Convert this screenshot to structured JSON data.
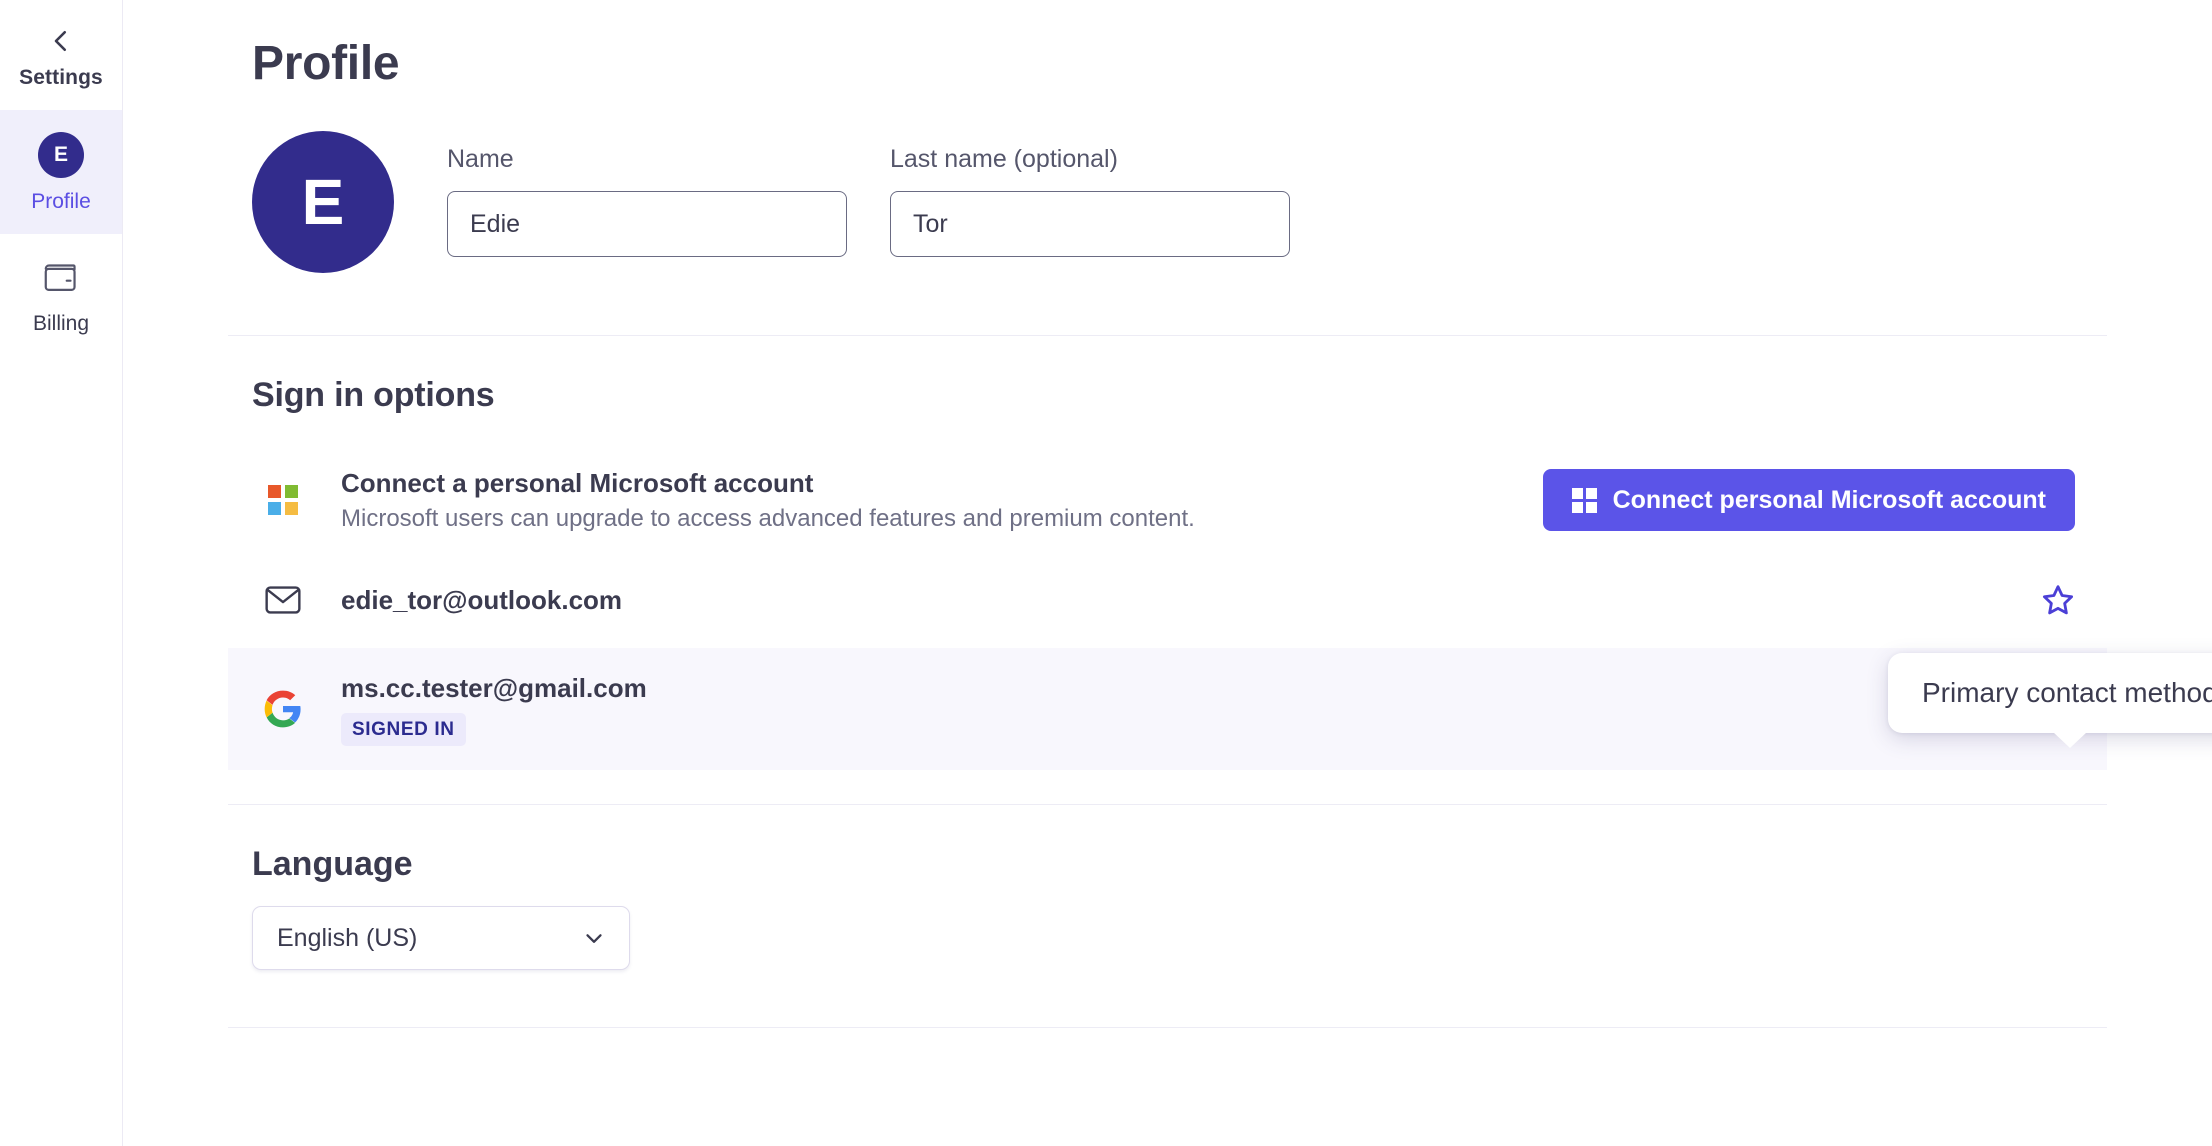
{
  "sidebar": {
    "back": {
      "label": "Settings",
      "icon": "chevron-left-icon"
    },
    "items": [
      {
        "label": "Profile",
        "icon": "avatar-icon",
        "avatar_initial": "E",
        "active": true
      },
      {
        "label": "Billing",
        "icon": "wallet-icon",
        "active": false
      }
    ]
  },
  "page": {
    "title": "Profile"
  },
  "profile": {
    "avatar_initial": "E",
    "fields": [
      {
        "label": "Name",
        "value": "Edie",
        "placeholder": "Name"
      },
      {
        "label": "Last name (optional)",
        "value": "Tor",
        "placeholder": "Last name"
      }
    ]
  },
  "signin": {
    "title": "Sign in options",
    "rows": [
      {
        "icon": "microsoft-logo-icon",
        "title": "Connect a personal Microsoft account",
        "subtitle": "Microsoft users can upgrade to access advanced features and premium content.",
        "button": {
          "label": "Connect personal Microsoft account",
          "icon": "microsoft-grid-icon"
        }
      },
      {
        "icon": "envelope-icon",
        "email": "edie_tor@outlook.com",
        "star": {
          "name": "star-icon",
          "state": "outline"
        }
      },
      {
        "icon": "google-logo-icon",
        "email": "ms.cc.tester@gmail.com",
        "badge": "SIGNED IN",
        "star": {
          "name": "star-filled-icon",
          "state": "filled"
        },
        "highlighted": true
      }
    ]
  },
  "tooltip": {
    "text": "Primary contact method"
  },
  "language": {
    "title": "Language",
    "selected": "English (US)",
    "chevron": "chevron-down-icon"
  },
  "colors": {
    "accent": "#5b54e8",
    "avatar": "#322c8c",
    "sidebar_active_bg": "#f0effb",
    "row_highlight_bg": "#f8f7fd",
    "badge_bg": "#eceafb",
    "badge_text": "#2b2b8f",
    "text": "#3b3b4f",
    "muted": "#6f7086",
    "ms_red": "#e8582a",
    "ms_green": "#80bb32",
    "ms_blue": "#4aaee8",
    "ms_yellow": "#f5bc42",
    "g_red": "#ea4335",
    "g_yellow": "#fbbc05",
    "g_green": "#34a853",
    "g_blue": "#4285f4"
  }
}
